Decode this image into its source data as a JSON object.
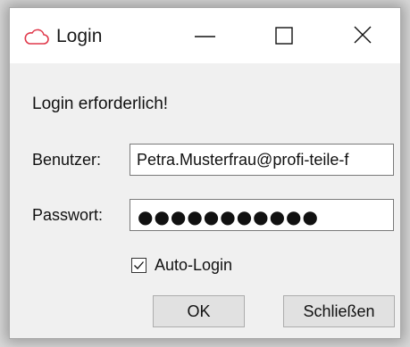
{
  "window": {
    "title": "Login",
    "app_icon": "cloud-icon",
    "controls": {
      "minimize": "minimize-icon",
      "maximize": "maximize-icon",
      "close": "close-icon"
    }
  },
  "dialog": {
    "message": "Login erforderlich!",
    "user_label": "Benutzer:",
    "user_value": "Petra.Musterfrau@profi-teile-f",
    "password_label": "Passwort:",
    "password_masked": "●●●●●●●●●●●",
    "auto_login_label": "Auto-Login",
    "auto_login_checked": true,
    "ok_label": "OK",
    "close_label": "Schließen"
  },
  "colors": {
    "icon_accent": "#e0394b",
    "window_bg": "#f0f0f0",
    "button_bg": "#e1e1e1"
  }
}
